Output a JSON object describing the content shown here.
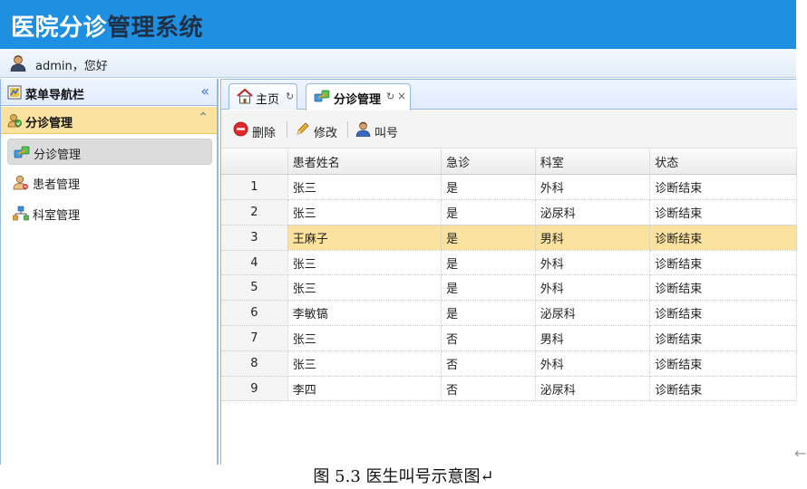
{
  "app": {
    "title_part1": "医院分诊",
    "title_part2": "管理系统",
    "user_text": "admin，您好",
    "colors": {
      "banner": "#1e8fe1",
      "accordion_active": "#fbe29e",
      "border": "#95b8e7"
    }
  },
  "sidebar": {
    "header_label": "菜单导航栏",
    "collapse_glyph": "«",
    "group": {
      "label": "分诊管理",
      "toggle_glyph": "⌃"
    },
    "items": [
      {
        "label": "分诊管理",
        "icon": "link-icon",
        "active": true
      },
      {
        "label": "患者管理",
        "icon": "user-icon",
        "active": false
      },
      {
        "label": "科室管理",
        "icon": "hierarchy-icon",
        "active": false
      }
    ]
  },
  "tabs": [
    {
      "label": "主页",
      "refresh": "↻",
      "close": ""
    },
    {
      "label": "分诊管理",
      "refresh": "↻",
      "close": "×"
    }
  ],
  "toolbar": {
    "delete_label": "删除",
    "edit_label": "修改",
    "call_label": "叫号"
  },
  "grid": {
    "columns": [
      "患者姓名",
      "急诊",
      "科室",
      "状态"
    ],
    "rows": [
      {
        "n": "1",
        "name": "张三",
        "er": "是",
        "dept": "外科",
        "status": "诊断结束"
      },
      {
        "n": "2",
        "name": "张三",
        "er": "是",
        "dept": "泌尿科",
        "status": "诊断结束"
      },
      {
        "n": "3",
        "name": "王麻子",
        "er": "是",
        "dept": "男科",
        "status": "诊断结束",
        "selected": true
      },
      {
        "n": "4",
        "name": "张三",
        "er": "是",
        "dept": "外科",
        "status": "诊断结束"
      },
      {
        "n": "5",
        "name": "张三",
        "er": "是",
        "dept": "外科",
        "status": "诊断结束"
      },
      {
        "n": "6",
        "name": "李敏镐",
        "er": "是",
        "dept": "泌尿科",
        "status": "诊断结束"
      },
      {
        "n": "7",
        "name": "张三",
        "er": "否",
        "dept": "男科",
        "status": "诊断结束"
      },
      {
        "n": "8",
        "name": "张三",
        "er": "否",
        "dept": "外科",
        "status": "诊断结束"
      },
      {
        "n": "9",
        "name": "李四",
        "er": "否",
        "dept": "泌尿科",
        "status": "诊断结束"
      }
    ]
  },
  "caption": "图 5.3 医生叫号示意图↵",
  "edge_arrow": "←"
}
